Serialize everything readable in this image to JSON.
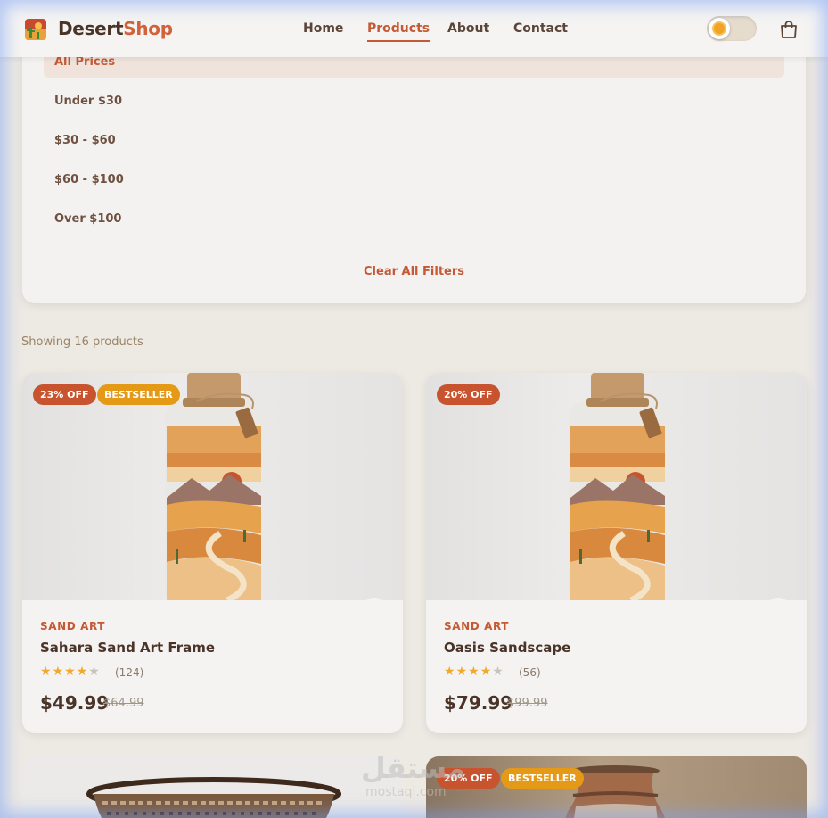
{
  "header": {
    "brand_part1": "Desert",
    "brand_part2": "Shop",
    "nav": [
      "Home",
      "Products",
      "About",
      "Contact"
    ],
    "active_nav": "Products",
    "icons": [
      "logo-icon",
      "theme-toggle-sun-icon",
      "shopping-bag-icon"
    ]
  },
  "filters": {
    "price_options": [
      "All Prices",
      "Under $30",
      "$30 - $60",
      "$60 - $100",
      "Over $100"
    ],
    "selected": "All Prices",
    "clear_label": "Clear All Filters"
  },
  "results": {
    "count_text": "Showing 16 products"
  },
  "products": [
    {
      "badges": [
        "23% OFF",
        "BESTSELLER"
      ],
      "category": "SAND ART",
      "name": "Sahara Sand Art Frame",
      "rating": 4,
      "reviews": "(124)",
      "price": "$49.99",
      "old_price": "$64.99"
    },
    {
      "badges": [
        "20% OFF"
      ],
      "category": "SAND ART",
      "name": "Oasis Sandscape",
      "rating": 4,
      "reviews": "(56)",
      "price": "$79.99",
      "old_price": "$99.99"
    },
    {
      "badges": [],
      "category": "",
      "name": "",
      "image": "woven-basket"
    },
    {
      "badges": [
        "20% OFF",
        "BESTSELLER"
      ],
      "category": "",
      "name": "",
      "image": "ceramic-vase"
    }
  ],
  "watermark": {
    "arabic": "مستقل",
    "latin": "mostaql.com"
  },
  "colors": {
    "accent": "#c45a35",
    "badge_discount": "#c7532f",
    "badge_bestseller": "#e49a16",
    "star": "#f0a92d"
  }
}
